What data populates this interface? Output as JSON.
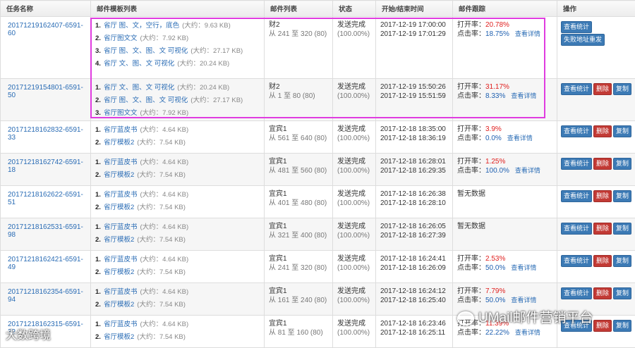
{
  "headers": [
    "任务名称",
    "邮件模板列表",
    "邮件列表",
    "状态",
    "开始/结束时间",
    "邮件跟踪",
    "操作"
  ],
  "labels": {
    "open_rate": "打开率：",
    "click_rate": "点击率：",
    "view_detail": "查看详情",
    "no_data": "暂无数据"
  },
  "buttons": {
    "stats": "查看统计",
    "resend": "失败地址重发",
    "delete": "删除",
    "copy": "复制"
  },
  "rows": [
    {
      "task": "20171219162407-6591-60",
      "templates": [
        {
          "n": "1.",
          "name": "省厅 图、文，空行，底色",
          "size": "(大约：9.63 KB)"
        },
        {
          "n": "2.",
          "name": "省厅图文文",
          "size": "(大约：7.92 KB)"
        },
        {
          "n": "3.",
          "name": "省厅 图、文、图、文 可视化",
          "size": "(大约：27.17 KB)"
        },
        {
          "n": "4.",
          "name": "省厅 文、图、文 可视化",
          "size": "(大约：20.24 KB)"
        }
      ],
      "list": "财2",
      "range": "从 241 至 320 (80)",
      "status": "发送完成",
      "status_pct": "(100.00%)",
      "start": "2017-12-19 17:00:00",
      "end": "2017-12-19 17:01:29",
      "open": "20.78%",
      "click": "18.75%",
      "has_data": true,
      "first": true
    },
    {
      "task": "20171219154801-6591-50",
      "templates": [
        {
          "n": "1.",
          "name": "省厅 文、图、文 可视化",
          "size": "(大约：20.24 KB)"
        },
        {
          "n": "2.",
          "name": "省厅 图、文、图、文 可视化",
          "size": "(大约：27.17 KB)"
        },
        {
          "n": "3.",
          "name": "省厅图文文",
          "size": "(大约：7.92 KB)"
        }
      ],
      "list": "财2",
      "range": "从 1 至 80 (80)",
      "status": "发送完成",
      "status_pct": "(100.00%)",
      "start": "2017-12-19 15:50:26",
      "end": "2017-12-19 15:51:59",
      "open": "31.17%",
      "click": "8.33%",
      "has_data": true
    },
    {
      "task": "20171218162832-6591-33",
      "templates": [
        {
          "n": "1.",
          "name": "省厅蓝皮书",
          "size": "(大约：4.64 KB)"
        },
        {
          "n": "2.",
          "name": "省厅模板2",
          "size": "(大约：7.54 KB)"
        }
      ],
      "list": "宜宾1",
      "range": "从 561 至 640 (80)",
      "status": "发送完成",
      "status_pct": "(100.00%)",
      "start": "2017-12-18 18:35:00",
      "end": "2017-12-18 18:36:19",
      "open": "3.9%",
      "click": "0.0%",
      "has_data": true
    },
    {
      "task": "20171218162742-6591-18",
      "templates": [
        {
          "n": "1.",
          "name": "省厅蓝皮书",
          "size": "(大约：4.64 KB)"
        },
        {
          "n": "2.",
          "name": "省厅模板2",
          "size": "(大约：7.54 KB)"
        }
      ],
      "list": "宜宾1",
      "range": "从 481 至 560 (80)",
      "status": "发送完成",
      "status_pct": "(100.00%)",
      "start": "2017-12-18 16:28:01",
      "end": "2017-12-18 16:29:35",
      "open": "1.25%",
      "click": "100.0%",
      "has_data": true
    },
    {
      "task": "20171218162622-6591-51",
      "templates": [
        {
          "n": "1.",
          "name": "省厅蓝皮书",
          "size": "(大约：4.64 KB)"
        },
        {
          "n": "2.",
          "name": "省厅模板2",
          "size": "(大约：7.54 KB)"
        }
      ],
      "list": "宜宾1",
      "range": "从 401 至 480 (80)",
      "status": "发送完成",
      "status_pct": "(100.00%)",
      "start": "2017-12-18 16:26:38",
      "end": "2017-12-18 16:28:10",
      "has_data": false
    },
    {
      "task": "20171218162531-6591-98",
      "templates": [
        {
          "n": "1.",
          "name": "省厅蓝皮书",
          "size": "(大约：4.64 KB)"
        },
        {
          "n": "2.",
          "name": "省厅模板2",
          "size": "(大约：7.54 KB)"
        }
      ],
      "list": "宜宾1",
      "range": "从 321 至 400 (80)",
      "status": "发送完成",
      "status_pct": "(100.00%)",
      "start": "2017-12-18 16:26:05",
      "end": "2017-12-18 16:27:39",
      "has_data": false
    },
    {
      "task": "20171218162421-6591-49",
      "templates": [
        {
          "n": "1.",
          "name": "省厅蓝皮书",
          "size": "(大约：4.64 KB)"
        },
        {
          "n": "2.",
          "name": "省厅模板2",
          "size": "(大约：7.54 KB)"
        }
      ],
      "list": "宜宾1",
      "range": "从 241 至 320 (80)",
      "status": "发送完成",
      "status_pct": "(100.00%)",
      "start": "2017-12-18 16:24:41",
      "end": "2017-12-18 16:26:09",
      "open": "2.53%",
      "click": "50.0%",
      "has_data": true
    },
    {
      "task": "20171218162354-6591-94",
      "templates": [
        {
          "n": "1.",
          "name": "省厅蓝皮书",
          "size": "(大约：4.64 KB)"
        },
        {
          "n": "2.",
          "name": "省厅模板2",
          "size": "(大约：7.54 KB)"
        }
      ],
      "list": "宜宾1",
      "range": "从 161 至 240 (80)",
      "status": "发送完成",
      "status_pct": "(100.00%)",
      "start": "2017-12-18 16:24:12",
      "end": "2017-12-18 16:25:40",
      "open": "7.79%",
      "click": "50.0%",
      "has_data": true
    },
    {
      "task": "20171218162315-6591-32",
      "templates": [
        {
          "n": "1.",
          "name": "省厅蓝皮书",
          "size": "(大约：4.64 KB)"
        },
        {
          "n": "2.",
          "name": "省厅模板2",
          "size": "(大约：7.54 KB)"
        }
      ],
      "list": "宜宾1",
      "range": "从 81 至 160 (80)",
      "status": "发送完成",
      "status_pct": "(100.00%)",
      "start": "2017-12-18 16:23:46",
      "end": "2017-12-18 16:25:11",
      "open": "11.39%",
      "click": "22.22%",
      "has_data": true
    }
  ],
  "watermark": {
    "left": "大数跨境",
    "right": "UMail邮件营销平台"
  },
  "colors": {
    "link": "#2a6cb5",
    "open_rate": "#e0201f",
    "click_rate": "#1e5fb0",
    "highlight": "#e03ce0",
    "btn_blue": "#3c7ab5",
    "btn_red": "#c23a35"
  }
}
